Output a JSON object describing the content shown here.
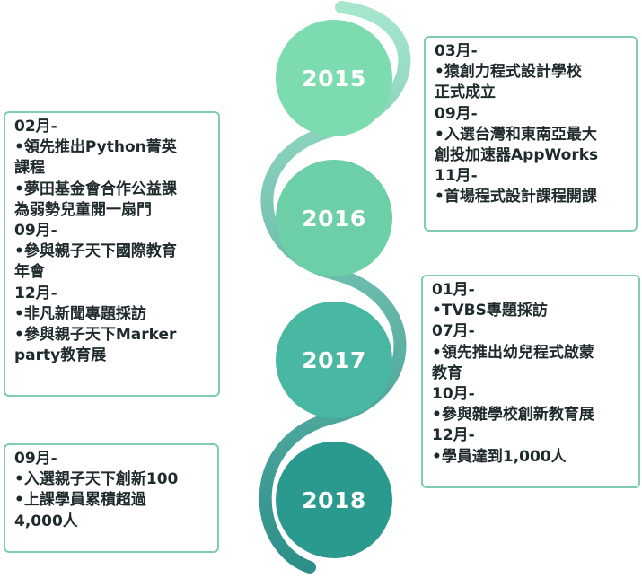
{
  "years": [
    "2015",
    "2016",
    "2017",
    "2018"
  ],
  "colors": {
    "circle_2015": "#7ddbb0",
    "circle_2016": "#6ccfa8",
    "circle_2017": "#49b8a2",
    "circle_2018": "#2a9a8f",
    "curve_start": "#a6e6cc",
    "curve_end": "#2c8f89",
    "box_border": "#7fcbb4"
  },
  "events": {
    "e2015": [
      "03月-",
      "•猿創力程式設計學校",
      "正式成立",
      "09月-",
      "•入選台灣和東南亞最大",
      "創投加速器AppWorks",
      "11月-",
      "•首場程式設計課程開課"
    ],
    "e2016": [
      "02月-",
      "•領先推出Python菁英",
      "課程",
      "•夢田基金會合作公益課",
      "為弱勢兒童開一扇門",
      "09月-",
      "•參與親子天下國際教育",
      "年會",
      "12月-",
      "•非凡新聞專題採訪",
      "•參與親子天下Marker",
      "party教育展"
    ],
    "e2017": [
      "01月-",
      "•TVBS專題採訪",
      "07月-",
      "•領先推出幼兒程式啟蒙",
      "教育",
      "10月-",
      "•參與雜學校創新教育展",
      "12月-",
      "•學員達到1,000人"
    ],
    "e2018": [
      "09月-",
      "•入選親子天下創新100",
      "•上課學員累積超過",
      "4,000人"
    ]
  }
}
